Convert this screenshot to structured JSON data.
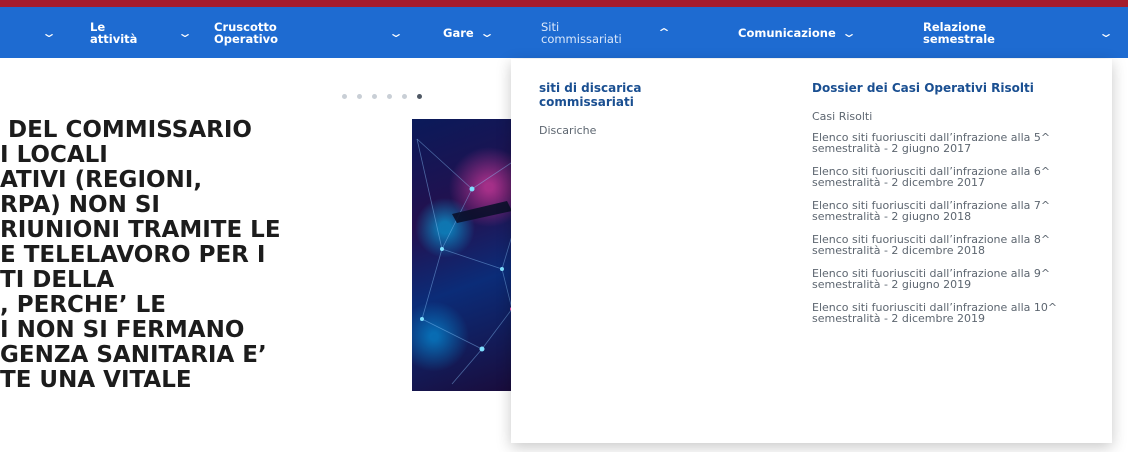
{
  "nav": {
    "items": [
      {
        "label": "Le attività",
        "has_chevron": true
      },
      {
        "label": "Cruscotto Operativo",
        "has_chevron": true
      },
      {
        "label": "Gare",
        "has_chevron": true
      },
      {
        "label": "Siti commissariati",
        "has_chevron": true,
        "expanded": true
      },
      {
        "label": "Comunicazione",
        "has_chevron": true
      },
      {
        "label": "Relazione semestrale",
        "has_chevron": true
      }
    ]
  },
  "carousel": {
    "dot_count": 6,
    "active_index": 5,
    "headline_lines": [
      "DEL COMMISSARIO",
      "I LOCALI",
      "ATIVI (REGIONI,",
      "RPA) NON SI",
      "RIUNIONI TRAMITE LE",
      "E TELELAVORO PER I",
      "TI DELLA",
      ", PERCHE’ LE",
      "I NON SI FERMANO",
      "GENZA SANITARIA E’",
      "TE UNA VITALE"
    ]
  },
  "dropdown": {
    "col1": {
      "title": "siti di discarica commissariati",
      "links": [
        "Discariche"
      ]
    },
    "col2": {
      "title": "Dossier dei Casi Operativi Risolti",
      "links": [
        "Casi Risolti",
        "Elenco siti fuoriusciti dall’infrazione alla 5^ semestralità - 2 giugno 2017",
        "Elenco siti fuoriusciti dall’infrazione alla 6^ semestralità - 2 dicembre 2017",
        "Elenco siti fuoriusciti dall’infrazione alla 7^ semestralità - 2 giugno 2018",
        "Elenco siti fuoriusciti dall’infrazione alla 8^ semestralità - 2 dicembre 2018",
        "Elenco siti fuoriusciti dall’infrazione alla 9^ semestralità - 2 giugno 2019",
        "Elenco siti fuoriusciti dall’infrazione alla 10^ semestralità - 2 dicembre 2019"
      ]
    }
  },
  "colors": {
    "nav_bg": "#1e6bd1",
    "top_line": "#a51c2d",
    "dropdown_title": "#1a4f91",
    "link_text": "#5d6670"
  },
  "icons": [
    "chevron-down-icon",
    "chevron-up-icon"
  ]
}
